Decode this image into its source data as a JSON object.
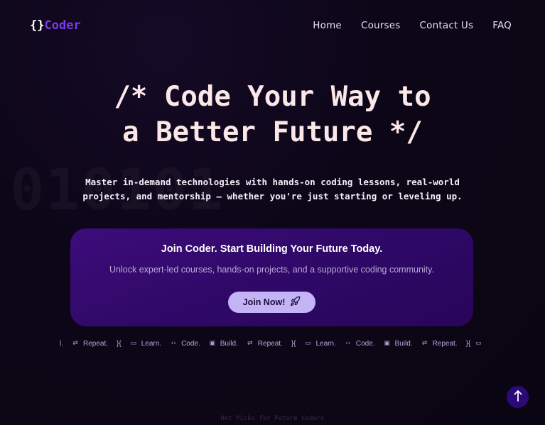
{
  "nav": {
    "logo_braces": "{}",
    "logo_name": "Coder",
    "links": [
      "Home",
      "Courses",
      "Contact Us",
      "FAQ"
    ]
  },
  "background_text": "010101",
  "hero": {
    "title_line1": "/* Code Your Way to",
    "title_line2": "a Better Future */",
    "subtitle_line1": "Master in-demand technologies with hands-on coding lessons, real-world",
    "subtitle_line2": "projects, and mentorship — whether you're just starting or leveling up."
  },
  "cta": {
    "title": "Join Coder. Start Building Your Future Today.",
    "text": "Unlock expert-led courses, hands-on projects, and a supportive coding community.",
    "button_label": "Join Now!"
  },
  "ticker": {
    "lead": "l.",
    "items": [
      {
        "icon": "repeat-icon",
        "label": "Repeat."
      },
      {
        "icon": "braces-icon",
        "label": "}{"
      },
      {
        "icon": "laptop-icon",
        "label": "Learn."
      },
      {
        "icon": "code-icon",
        "label": "Code."
      },
      {
        "icon": "folder-icon",
        "label": "Build."
      },
      {
        "icon": "repeat-icon",
        "label": "Repeat."
      },
      {
        "icon": "braces-icon",
        "label": "}{"
      },
      {
        "icon": "laptop-icon",
        "label": "Learn."
      },
      {
        "icon": "code-icon",
        "label": "Code."
      },
      {
        "icon": "folder-icon",
        "label": "Build."
      },
      {
        "icon": "repeat-icon",
        "label": "Repeat."
      },
      {
        "icon": "braces-icon",
        "label": "}{"
      }
    ]
  },
  "footer_hint": "Hot Picks for Future Coders",
  "colors": {
    "background": "#0d0618",
    "brand": "#7c3aed",
    "card": "#2e0866",
    "button": "#c4b3f6",
    "scroll_button": "#2b0a78"
  }
}
